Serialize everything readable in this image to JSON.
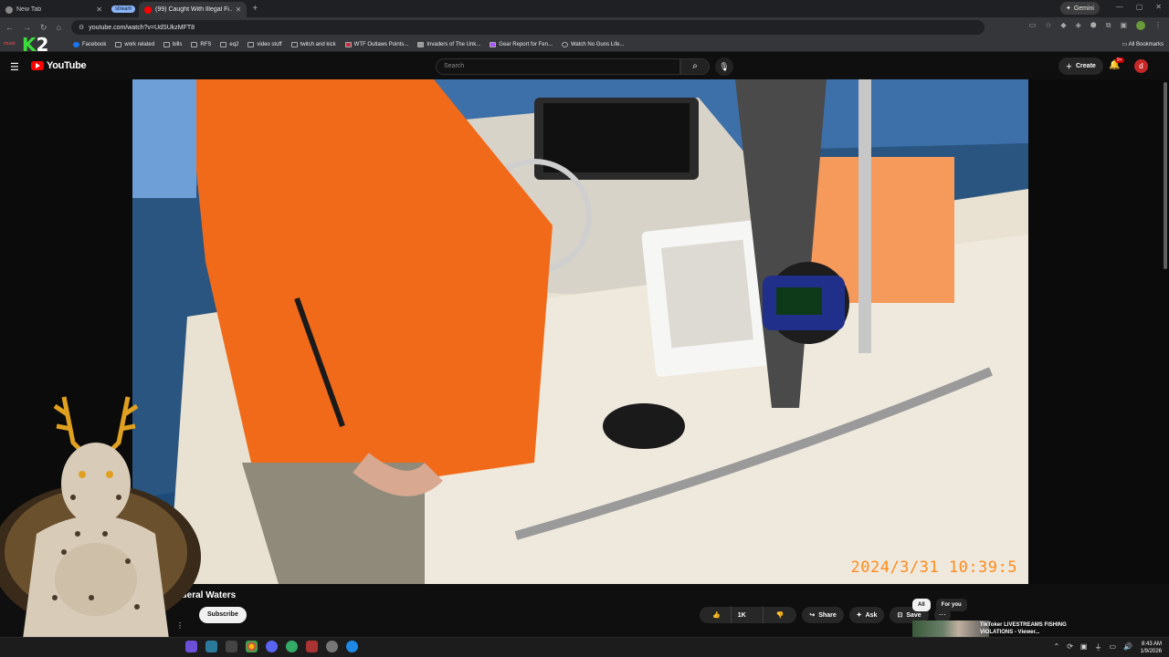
{
  "browser": {
    "tabs": [
      {
        "title": "New Tab",
        "active": false
      },
      {
        "title": "(99) Caught With Illegal Fi...",
        "active": true
      }
    ],
    "tab_group_label": "stream",
    "gemini_label": "Gemini",
    "url": "youtube.com/watch?v=UdSUkzMFT8"
  },
  "bookmarks": {
    "items": [
      "Facebook",
      "work related",
      "bills",
      "RFS",
      "eq2",
      "video stuff",
      "twitch and kick",
      "WTF Outlaws Points...",
      "Invaders of The Unk...",
      "Gear Report for Fen...",
      "Watch No Guns Life..."
    ],
    "all_label": "All Bookmarks",
    "k2_logo": "2",
    "music_label": "music"
  },
  "youtube": {
    "logo_text": "YouTube",
    "search_placeholder": "Search",
    "create_label": "Create",
    "notif_count": "9+",
    "avatar_letter": "d"
  },
  "video": {
    "timestamp_overlay": "2024/3/31  10:39:5",
    "title_visible": "ederal Waters",
    "subscribe_label": "Subscribe",
    "like_count": "1K",
    "share_label": "Share",
    "ask_label": "Ask",
    "save_label": "Save"
  },
  "sidebar": {
    "chips": [
      "All",
      "For you"
    ],
    "rec_title": "TikToker LIVESTREAMS FISHING VIOLATIONS - Viewer..."
  },
  "taskbar": {
    "time": "8:43 AM",
    "date": "1/9/2026"
  },
  "colors": {
    "yt_red": "#ff0000",
    "timestamp_orange": "#ff8a1c",
    "jacket_orange": "#f06a1a"
  }
}
